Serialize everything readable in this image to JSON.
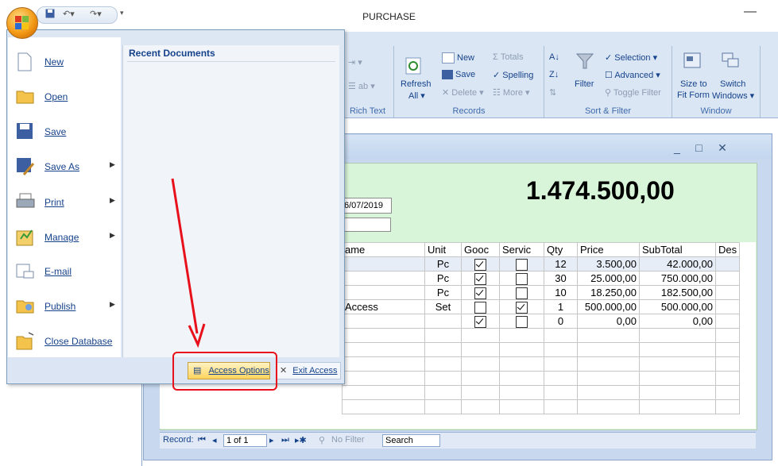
{
  "window": {
    "title": "PURCHASE",
    "minimize_glyph": "—"
  },
  "qat": {
    "icons": [
      "save-icon",
      "undo-icon",
      "redo-icon"
    ],
    "dropdown_glyph": "▾"
  },
  "ribbon": {
    "groups": [
      {
        "label": "Rich Text"
      },
      {
        "label": "Records",
        "refresh": "Refresh",
        "refresh_sub": "All ▾",
        "new": "New",
        "save": "Save",
        "delete": "Delete ▾",
        "totals": "Totals",
        "spelling": "Spelling",
        "more": "More ▾"
      },
      {
        "label": "Sort & Filter",
        "filter": "Filter",
        "selection": "Selection ▾",
        "advanced": "Advanced ▾",
        "toggle_filter": "Toggle Filter"
      },
      {
        "label": "Window",
        "size_to": "Size to",
        "fit_form": "Fit Form",
        "switch": "Switch",
        "windows": "Windows ▾"
      }
    ]
  },
  "form": {
    "total": "1.474.500,00",
    "date_value": "6/07/2019",
    "columns": [
      "ame",
      "Unit",
      "Gooc",
      "Servic",
      "Qty",
      "Price",
      "SubTotal",
      "Des"
    ],
    "rows": [
      {
        "name": "",
        "unit": "Pc",
        "goods": true,
        "service": false,
        "qty": "12",
        "price": "3.500,00",
        "subtotal": "42.000,00"
      },
      {
        "name": "",
        "unit": "Pc",
        "goods": true,
        "service": false,
        "qty": "30",
        "price": "25.000,00",
        "subtotal": "750.000,00"
      },
      {
        "name": "",
        "unit": "Pc",
        "goods": true,
        "service": false,
        "qty": "10",
        "price": "18.250,00",
        "subtotal": "182.500,00"
      },
      {
        "name": "Access",
        "unit": "Set",
        "goods": false,
        "service": true,
        "qty": "1",
        "price": "500.000,00",
        "subtotal": "500.000,00"
      },
      {
        "name": "",
        "unit": "",
        "goods": true,
        "service": false,
        "qty": "0",
        "price": "0,00",
        "subtotal": "0,00"
      }
    ],
    "nav": {
      "record_label": "Record:",
      "record_value": "1 of 1",
      "no_filter": "No Filter",
      "search": "Search"
    }
  },
  "office_menu": {
    "items": [
      {
        "label": "New",
        "icon": "new-document-icon",
        "submenu": false
      },
      {
        "label": "Open",
        "icon": "open-folder-icon",
        "submenu": false
      },
      {
        "label": "Save",
        "icon": "floppy-save-icon",
        "submenu": false
      },
      {
        "label": "Save As",
        "icon": "save-as-icon",
        "submenu": true
      },
      {
        "label": "Print",
        "icon": "printer-icon",
        "submenu": true
      },
      {
        "label": "Manage",
        "icon": "manage-icon",
        "submenu": true
      },
      {
        "label": "E-mail",
        "icon": "email-icon",
        "submenu": false
      },
      {
        "label": "Publish",
        "icon": "publish-icon",
        "submenu": true
      },
      {
        "label": "Close Database",
        "icon": "close-database-icon",
        "submenu": false
      }
    ],
    "recent_title": "Recent Documents",
    "access_options": "Access Options",
    "exit_access": "Exit Access",
    "submenu_arrow": "▶"
  },
  "colors": {
    "annotation": "#e8101a",
    "form_bg": "#d9f5d9",
    "ribbon_bg": "#dbe6f4",
    "menu_text": "#15428b"
  }
}
